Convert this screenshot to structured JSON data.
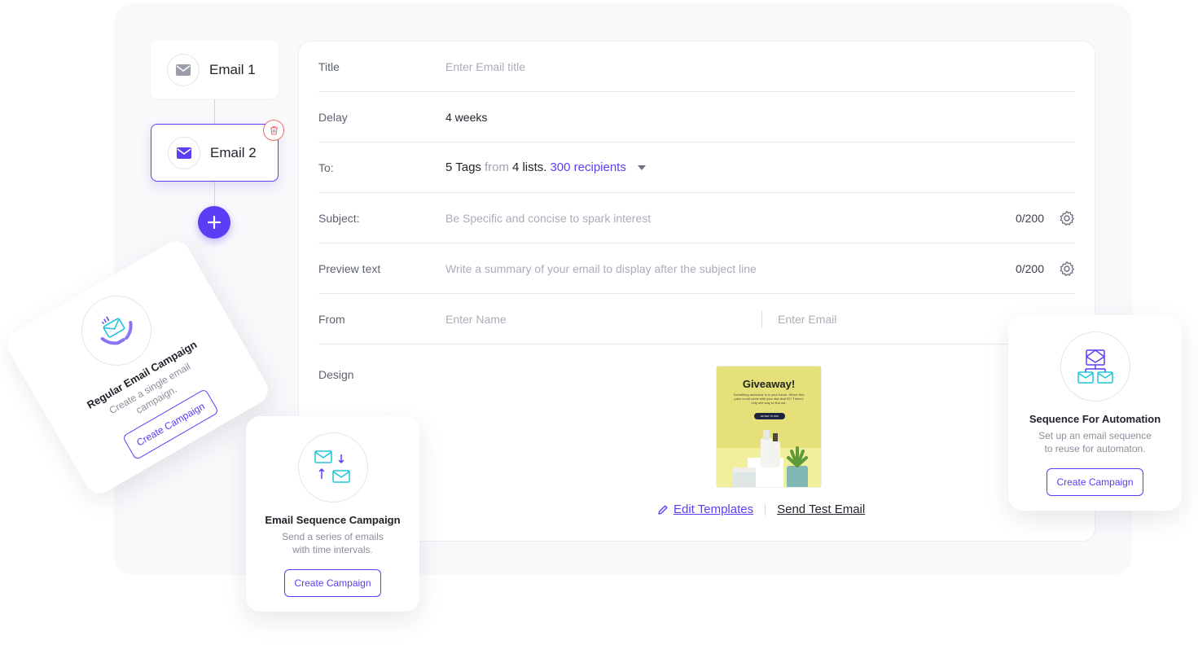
{
  "sequence": {
    "nodes": [
      {
        "label": "Email 1",
        "icon": "envelope-icon"
      },
      {
        "label": "Email 2",
        "icon": "envelope-icon",
        "selected": true
      }
    ],
    "delete_icon": "trash-icon",
    "add_icon": "plus-icon"
  },
  "form": {
    "title": {
      "label": "Title",
      "placeholder": "Enter Email title"
    },
    "delay": {
      "label": "Delay",
      "value": "4 weeks"
    },
    "to": {
      "label": "To:",
      "tags": "5 Tags",
      "from_word": "from",
      "lists": "4 lists.",
      "recipients": "300 recipients"
    },
    "subject": {
      "label": "Subject:",
      "placeholder": "Be Specific and concise to spark interest",
      "count": "0/200"
    },
    "preview": {
      "label": "Preview text",
      "placeholder": "Write a summary of your email to display after the subject line",
      "count": "0/200"
    },
    "from": {
      "label": "From",
      "name_placeholder": "Enter Name",
      "email_placeholder": "Enter Email"
    },
    "design": {
      "label": "Design",
      "template": {
        "title": "Giveaway!",
        "subtitle": "Something awesome is in your future. Which free prize could come with your last deal ID? There's only one way to find out.",
        "button": "ENTER TO WIN"
      },
      "edit_label": "Edit Templates",
      "test_label": "Send Test Email"
    }
  },
  "cards": {
    "regular": {
      "title": "Regular Email Campaign",
      "desc": "Create a single email campaign.",
      "button": "Create Campaign"
    },
    "sequence": {
      "title": "Email Sequence Campaign",
      "desc1": "Send a series of emails",
      "desc2": "with time intervals.",
      "button": "Create Campaign"
    },
    "automation": {
      "title": "Sequence For Automation",
      "desc1": "Set up an email sequence",
      "desc2": "to reuse for automaton.",
      "button": "Create Campaign"
    }
  },
  "colors": {
    "accent": "#5b3df5",
    "teal": "#1fc5d8",
    "danger": "#f06b6b"
  }
}
